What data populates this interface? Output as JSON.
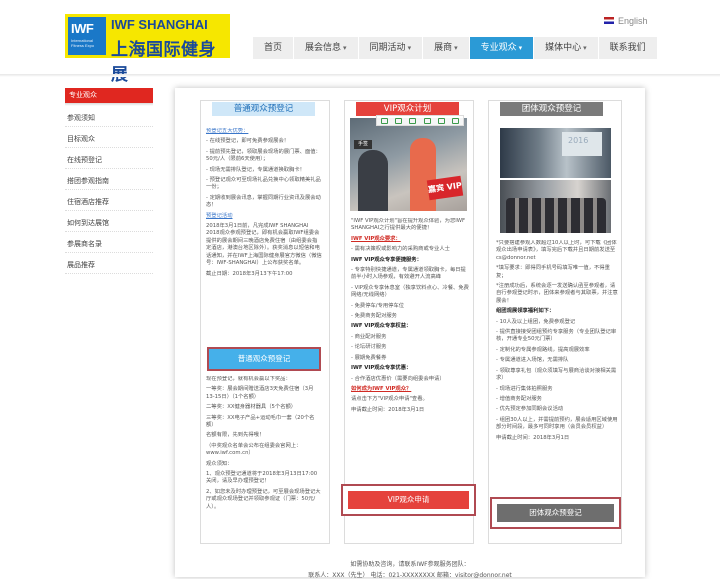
{
  "header": {
    "logo_mark": "IWF",
    "logo_mark_small": "International Fitness Expo",
    "logo_en": "IWF SHANGHAI",
    "logo_cn": "上海国际健身展",
    "language": "English"
  },
  "nav": [
    {
      "label": "首页",
      "caret": false
    },
    {
      "label": "展会信息",
      "caret": true
    },
    {
      "label": "同期活动",
      "caret": true
    },
    {
      "label": "展商",
      "caret": true
    },
    {
      "label": "专业观众",
      "caret": true,
      "active": true
    },
    {
      "label": "媒体中心",
      "caret": true
    },
    {
      "label": "联系我们",
      "caret": false
    }
  ],
  "sidebar": {
    "title": "专业观众",
    "items": [
      "参观须知",
      "目标观众",
      "在线预登记",
      "搭团参观指南",
      "住宿酒店推荐",
      "如何到达展馆",
      "参展商名录",
      "展品推荐"
    ]
  },
  "columns": {
    "normal": {
      "title": "普通观众预登记",
      "link1": "预登记五大优势：",
      "lines1": [
        "- 在线预登记，即可免费参观展会！",
        "- 提前预先登记，领取展会现场的展门票、面值：50元/人（限前6天使用）；",
        "- 现场无需排队登记，专属通道换取胸卡！",
        "- 预登记观众可至现场礼品兑换中心领取精美礼品一份；",
        "- 定期收到展会讯息，掌握同期行业资讯及展会动态！"
      ],
      "link2": "预登记活动",
      "lines2": [
        "2018年3月1日前，凡完成IWF SHANGHAI 2018观众参观预登记，即有机会赢取IWF组委会提供的展会期间三晚酒店免费住宿（由组委会指定酒店，港澳台地区除外）。获奖消息以短信和电话通知，并在IWF上海国际健身展官方微信（微信号：IWF-SHANGHAI）上公布获奖名单。",
        "截止日期：2018年3月13下午17:00"
      ],
      "button": "普通观众预登记",
      "lines3": [
        "现在预登记，就有机会赢以下奖品：",
        "一等奖：展会期间赠送酒店3天免费住宿（3月13-15日）（1个名额）",
        "二等奖：XX健身器材器具（5个名额）",
        "三等奖：XX电子产品+运动毛巾一套（20个名额）",
        "名额有限，先到先得哦！",
        "（中奖观众名单会公布在组委会官网上：www.iwf.com.cn）",
        "观众须知：",
        "1、观众预登记通道将于2018年3月13日17:00关闭，请及早办理预登记！",
        "2、如您未及时办理预登记，可至展会现场登记大厅或观众现场登记并领取参观证（门票：50元/人）。"
      ]
    },
    "vip": {
      "title": "VIP观众计划",
      "tag": "手签",
      "sign": "嘉宾 VIP",
      "intro": "\"IWF VIP观众计划\"旨在提升观众体验，为您IWF SHANGHAI之行提供最大的便捷！",
      "s1": "IWF VIP观众要求：",
      "s1_lines": [
        "- 需有决策权或影响力的采购商或专业人士"
      ],
      "s2": "IWF VIP观众专享便捷服务：",
      "s2_lines": [
        "- 专享特别快捷通道，专属通道领取胸卡，每日提前半小时入场参观，有效避开人流高峰",
        "- VIP观众专享休息室（独享饮料点心、冷餐、免费网络/无线网络）",
        "- 免费停车/专用停车位",
        "- 免费商务配对服务"
      ],
      "s3": "IWF VIP观众专享权益：",
      "s3_lines": [
        "- 商业配对服务",
        "- 论坛研讨服务",
        "- 展期免费餐券"
      ],
      "s4": "IWF VIP观众专享优惠：",
      "s4_lines": [
        "- 合作酒店优惠价（需要向组委会申请）"
      ],
      "s5": "如何成为IWF VIP观众？",
      "s5_lines": [
        "请点击下方\"VIP观众申请\"查看。",
        "申请截止时间：2018年3月1日"
      ],
      "button": "VIP观众申请"
    },
    "group": {
      "title": "团体观众预登记",
      "lines": [
        "*只要搭建参观人数超过10人以上时，可下载《团体观众出场申请表》，填写完后下载并且日期前发送至cs@donnor.net",
        "*填写要求：即得同手机号码填写唯一值，不得重复；",
        "*注册成功后，系统会逐一发送确认函至参观者，请自行参观登记时示，团体来参观者与其取票，并注意展会！"
      ],
      "benefits_title": "组团观展领享福利如下：",
      "benefits": [
        "- 10人及以上组团，免费参观登记",
        "- 提供直接接受团组预约专享服务（专业团队登记审核，开通专业50元门票）",
        "- 定制化的专属参观路线，提高观展效率",
        "- 专属通道进入场馆，无需排队",
        "- 领取尊享礼包（观众须填写与展商洽谈对接相关需求）",
        "- 现场进行集体拍照服务",
        "- 增值商务配对服务",
        "- 优先预定参加同期会议活动",
        "- 组团30人以上，并需提前预约，展会适用区域使用部分时间段，最多可同时享用（会员会员权益）"
      ],
      "deadline": "申请截止时间：2018年3月1日",
      "button": "团体观众预登记"
    }
  },
  "footer": {
    "line1": "如需协助及咨询，请联系IWF参观服务团队：",
    "line2": "联系人：XXX（先生）    电话：021-XXXXXXXX    邮箱：visitor@donnor.net"
  }
}
